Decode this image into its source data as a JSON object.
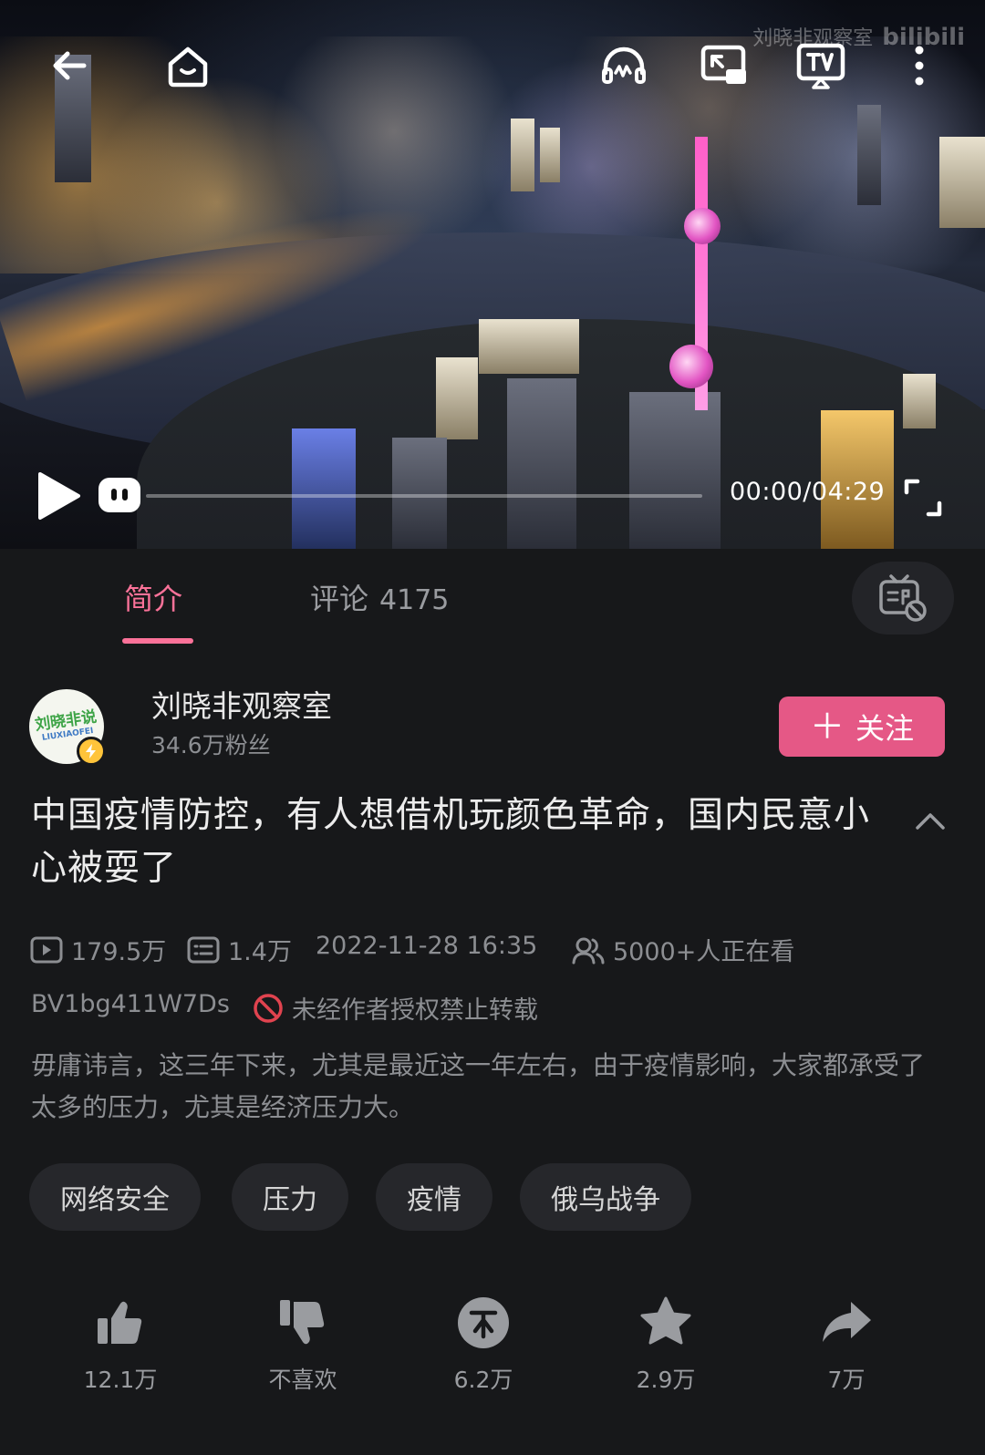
{
  "player": {
    "watermark_channel": "刘晓非观察室",
    "watermark_brand": "bilibili",
    "time_display": "00:00/04:29",
    "progress_fraction": 0,
    "icons": [
      "back-arrow-icon",
      "home-icon",
      "headphones-icon",
      "pip-icon",
      "tv-cast-icon",
      "more-icon",
      "play-icon",
      "danmaku-toggle-icon",
      "fullscreen-icon"
    ]
  },
  "tabs": [
    {
      "label": "简介",
      "active": true
    },
    {
      "label": "评论",
      "count": "4175",
      "active": false
    }
  ],
  "uploader": {
    "avatar_text": "刘晓非说",
    "avatar_subtext": "LIUXIAOFEI",
    "name": "刘晓非观察室",
    "fans": "34.6万粉丝",
    "follow_label": "关注",
    "follow_plus": "＋"
  },
  "video": {
    "title": "中国疫情防控，有人想借机玩颜色革命，国内民意小心被耍了",
    "views": "179.5万",
    "danmaku_count": "1.4万",
    "published": "2022-11-28 16:35",
    "watching_now": "5000+人正在看",
    "bvid": "BV1bg411W7Ds",
    "repost_notice": "未经作者授权禁止转载",
    "description": "毋庸讳言，这三年下来，尤其是最近这一年左右，由于疫情影响，大家都承受了太多的压力，尤其是经济压力大。"
  },
  "tags": [
    "网络安全",
    "压力",
    "疫情",
    "俄乌战争"
  ],
  "actions": [
    {
      "name": "like",
      "label": "12.1万"
    },
    {
      "name": "dislike",
      "label": "不喜欢"
    },
    {
      "name": "coin",
      "label": "6.2万"
    },
    {
      "name": "favorite",
      "label": "2.9万"
    },
    {
      "name": "share",
      "label": "7万"
    }
  ],
  "colors": {
    "accent": "#fb7299",
    "follow_button": "#e55886",
    "background": "#17181a",
    "tag_background": "#26272b",
    "verified_badge": "#ffc43a"
  }
}
